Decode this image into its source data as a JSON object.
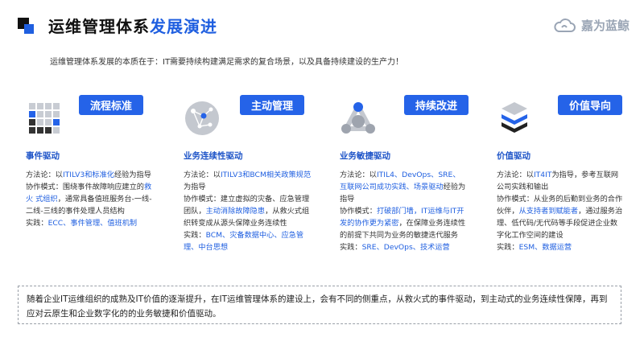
{
  "header": {
    "title_black": "运维管理体系",
    "title_blue": "发展演进",
    "brand": "嘉为蓝鲸",
    "colors": {
      "accent": "#1f5fe0",
      "badge": "#2563e8"
    }
  },
  "subtitle": "运维管理体系发展的本质在于：IT需要持续构建满足需求的复合场景，以及具备持续建设的生产力！",
  "columns": [
    {
      "badge": "流程标准",
      "icon": "grid-blocks-icon",
      "heading": "事件驱动",
      "l1a": "方法论：以",
      "l1b": "ITILV3和标准化",
      "l1c": "经验为指导",
      "l2a": "协作模式：围绕事件故障响应建立的",
      "l2b": "救火 式组织",
      "l2c": "，通常具备值班服务台-一线-二线-三线的事件处理人员结构",
      "l3a": "实践：",
      "l3b": "ECC、事件管理、值班机制"
    },
    {
      "badge": "主动管理",
      "icon": "network-globe-icon",
      "heading": "业务连续性驱动",
      "l1a": "方法论：以",
      "l1b": "ITILV3和BCM相关政策规范",
      "l1c": "为指导",
      "l2a": "协作模式：建立虚拟的灾备、应急管理团队，",
      "l2b": "主动消除故障隐患",
      "l2c": "，从救火式组织转变成从源头保障业务连续性",
      "l3a": "实践：",
      "l3b": "BCM、灾备数据中心、应急管理、中台思想"
    },
    {
      "badge": "持续改进",
      "icon": "collaboration-triangle-icon",
      "heading": "业务敏捷驱动",
      "l1a": "方法论：以",
      "l1b": "ITIL4、DevOps、SRE、互联网公司成功实践、场景驱动",
      "l1c": "经验为指导",
      "l2a": "协作模式：",
      "l2b": "打破部门墙，IT运维与IT开发的协作更为紧密",
      "l2c": "，在保障业务连续性的前提下共同为业务的敏捷迭代服务",
      "l3a": "实践：",
      "l3b": "SRE、DevOps、技术运营"
    },
    {
      "badge": "价值导向",
      "icon": "stacked-layers-icon",
      "heading": "价值驱动",
      "l1a": "方法论：以",
      "l1b": "IT4IT",
      "l1c": "为指导，参考互联网公司实践和输出",
      "l2a": "协作模式：从业务的后勤到业务的合作伙伴，",
      "l2b": "从支持者到赋能者",
      "l2c": "，通过服务治理、低代码/无代码等手段促进企业数字化工作空间的建设",
      "l3a": "实践：",
      "l3b": "ESM、数据运营"
    }
  ],
  "summary": "随着企业IT运维组织的成熟及IT价值的逐渐提升，在IT运维管理体系的建设上，会有不同的侧重点，从救火式的事件驱动，到主动式的业务连续性保障，再到应对云原生和企业数字化的的业务敏捷和价值驱动。"
}
